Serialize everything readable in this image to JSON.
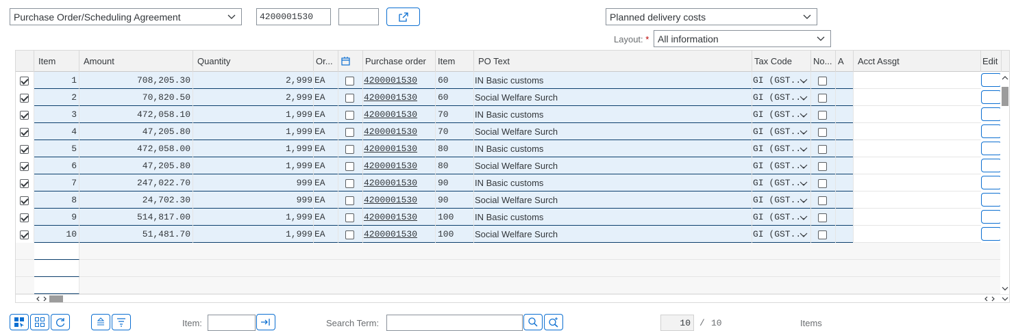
{
  "top": {
    "doc_type_select": "Purchase Order/Scheduling Agreement",
    "po_number_value": "4200001530",
    "second_field_value": "",
    "delivery_costs_select": "Planned delivery costs",
    "layout_label": "Layout:",
    "layout_required": "*",
    "layout_select": "All information"
  },
  "columns": [
    "Item",
    "Amount",
    "Quantity",
    "Or...",
    "",
    "Purchase order",
    "Item",
    "PO Text",
    "Tax Code",
    "No...",
    "A",
    "Acct Assgt",
    "Edit"
  ],
  "rows": [
    {
      "sel": true,
      "item": "1",
      "amount": "708,205.30",
      "qty": "2,999",
      "unit": "EA",
      "po": "4200001530",
      "po_item": "60",
      "text": "IN Basic customs",
      "tax": "GI (GST..."
    },
    {
      "sel": true,
      "item": "2",
      "amount": "70,820.50",
      "qty": "2,999",
      "unit": "EA",
      "po": "4200001530",
      "po_item": "60",
      "text": "Social Welfare Surch",
      "tax": "GI (GST..."
    },
    {
      "sel": true,
      "item": "3",
      "amount": "472,058.10",
      "qty": "1,999",
      "unit": "EA",
      "po": "4200001530",
      "po_item": "70",
      "text": "IN Basic customs",
      "tax": "GI (GST..."
    },
    {
      "sel": true,
      "item": "4",
      "amount": "47,205.80",
      "qty": "1,999",
      "unit": "EA",
      "po": "4200001530",
      "po_item": "70",
      "text": "Social Welfare Surch",
      "tax": "GI (GST..."
    },
    {
      "sel": true,
      "item": "5",
      "amount": "472,058.00",
      "qty": "1,999",
      "unit": "EA",
      "po": "4200001530",
      "po_item": "80",
      "text": "IN Basic customs",
      "tax": "GI (GST..."
    },
    {
      "sel": true,
      "item": "6",
      "amount": "47,205.80",
      "qty": "1,999",
      "unit": "EA",
      "po": "4200001530",
      "po_item": "80",
      "text": "Social Welfare Surch",
      "tax": "GI (GST..."
    },
    {
      "sel": true,
      "item": "7",
      "amount": "247,022.70",
      "qty": "999",
      "unit": "EA",
      "po": "4200001530",
      "po_item": "90",
      "text": "IN Basic customs",
      "tax": "GI (GST..."
    },
    {
      "sel": true,
      "item": "8",
      "amount": "24,702.30",
      "qty": "999",
      "unit": "EA",
      "po": "4200001530",
      "po_item": "90",
      "text": "Social Welfare Surch",
      "tax": "GI (GST..."
    },
    {
      "sel": true,
      "item": "9",
      "amount": "514,817.00",
      "qty": "1,999",
      "unit": "EA",
      "po": "4200001530",
      "po_item": "100",
      "text": "IN Basic customs",
      "tax": "GI (GST..."
    },
    {
      "sel": true,
      "item": "10",
      "amount": "51,481.70",
      "qty": "1,999",
      "unit": "EA",
      "po": "4200001530",
      "po_item": "100",
      "text": "Social Welfare Surch",
      "tax": "GI (GST..."
    }
  ],
  "toolbar": {
    "item_label": "Item:",
    "item_value": "",
    "search_label": "Search Term:",
    "search_value": "",
    "count_current": "10",
    "count_sep": "/",
    "count_total": "10",
    "items_label": "Items"
  },
  "colors": {
    "row_bg": "#e5f0fa",
    "row_border": "#0a3d6b",
    "header_bg": "#f2f2f2",
    "accent": "#0a6ed1"
  },
  "icons": [
    "chevron-down-icon",
    "open-link-icon",
    "checkbox-icon",
    "column-settings-icon",
    "select-all-icon",
    "deselect-all-icon",
    "refresh-icon",
    "sort-ascending-icon",
    "filter-icon",
    "goto-item-icon",
    "search-icon",
    "search-next-icon"
  ]
}
